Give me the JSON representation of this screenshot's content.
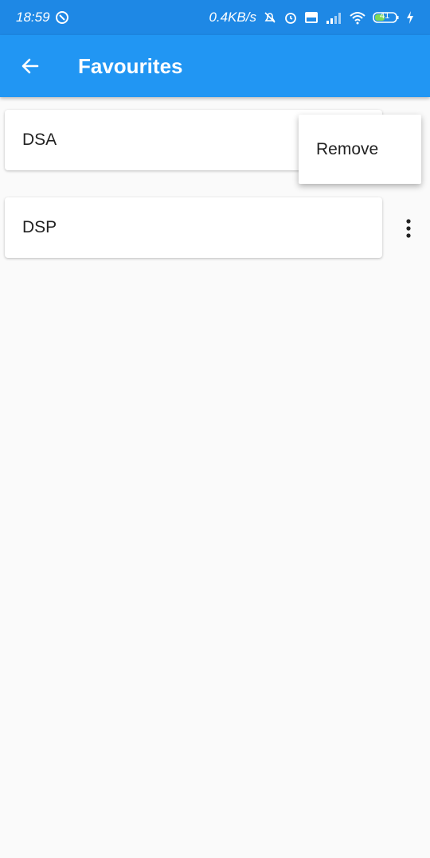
{
  "status_bar": {
    "time": "18:59",
    "network_speed": "0.4KB/s",
    "battery": "41",
    "icons": [
      "notification-ring-icon",
      "mute-icon",
      "alarm-icon",
      "volte-icon",
      "signal-icon",
      "wifi-icon",
      "battery-icon",
      "charging-icon"
    ]
  },
  "app_bar": {
    "title": "Favourites",
    "back_icon": "arrow-back-icon",
    "background": "#2196f3"
  },
  "favourites": [
    {
      "label": "DSA"
    },
    {
      "label": "DSP"
    }
  ],
  "menu": {
    "items": [
      {
        "label": "Remove"
      }
    ]
  }
}
